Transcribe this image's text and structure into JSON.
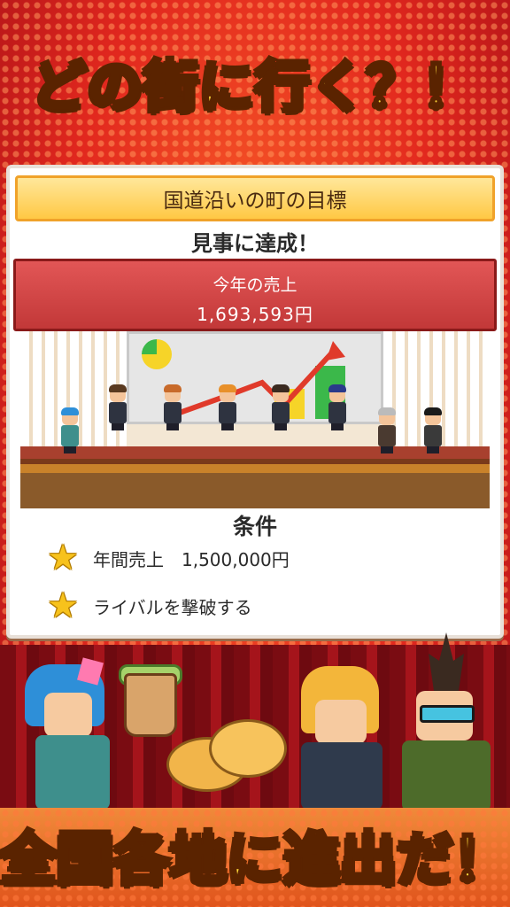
{
  "headline": "どの街に行く？！",
  "panel": {
    "title": "国道沿いの町の目標",
    "achieved": "見事に達成！",
    "sales_label": "今年の売上",
    "sales_value": "1,693,593円",
    "conditions_title": "条件",
    "conditions": [
      {
        "icon": "star-icon",
        "text": "年間売上　1,500,000円"
      },
      {
        "icon": "star-icon",
        "text": "ライバルを撃破する"
      }
    ]
  },
  "footer": "全国各地に進出だ！",
  "colors": {
    "headline_fill": "#ffd93a",
    "outline": "#5a2300",
    "sales_box": "#d04545",
    "title_bar": "#ffc844",
    "background": "#b3121a"
  }
}
